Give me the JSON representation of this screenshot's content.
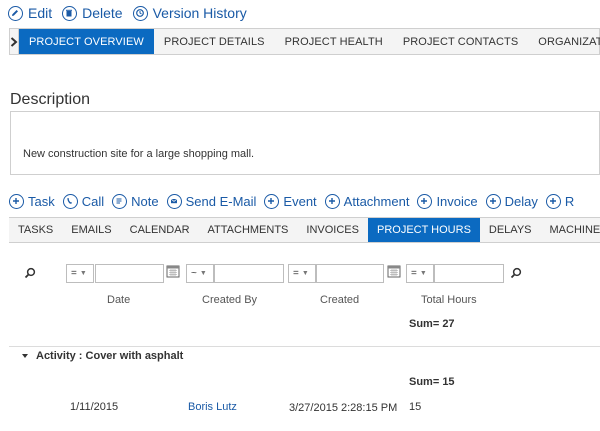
{
  "toolbar": {
    "edit_label": "Edit",
    "delete_label": "Delete",
    "version_history_label": "Version History"
  },
  "nav": {
    "tabs": [
      {
        "label": "PROJECT OVERVIEW",
        "active": true
      },
      {
        "label": "PROJECT DETAILS",
        "active": false
      },
      {
        "label": "PROJECT HEALTH",
        "active": false
      },
      {
        "label": "PROJECT CONTACTS",
        "active": false
      },
      {
        "label": "ORGANIZATIONS",
        "active": false
      }
    ]
  },
  "description": {
    "heading": "Description",
    "text": "New construction site for a large shopping mall."
  },
  "activities": {
    "items": [
      "Task",
      "Call",
      "Note",
      "Send E-Mail",
      "Event",
      "Attachment",
      "Invoice",
      "Delay",
      "R"
    ]
  },
  "subtabs": {
    "tabs": [
      {
        "label": "TASKS",
        "active": false
      },
      {
        "label": "EMAILS",
        "active": false
      },
      {
        "label": "CALENDAR",
        "active": false
      },
      {
        "label": "ATTACHMENTS",
        "active": false
      },
      {
        "label": "INVOICES",
        "active": false
      },
      {
        "label": "PROJECT HOURS",
        "active": true
      },
      {
        "label": "DELAYS",
        "active": false
      },
      {
        "label": "MACHINERY",
        "active": false
      }
    ]
  },
  "grid": {
    "filters": {
      "date_op": "=",
      "created_by_op": "~",
      "created_op": "=",
      "total_hours_op": "=",
      "date_value": "",
      "created_by_value": "",
      "created_value": "",
      "total_hours_value": ""
    },
    "columns": {
      "date": "Date",
      "created_by": "Created By",
      "created": "Created",
      "total_hours": "Total Hours"
    },
    "total_sum": "Sum= 27",
    "group": {
      "key": "Activity",
      "separator": " : ",
      "value": "Cover with asphalt",
      "sum": "Sum= 15"
    },
    "rows": [
      {
        "date": "1/11/2015",
        "created_by": "Boris Lutz",
        "created": "3/27/2015 2:28:15 PM",
        "total_hours": "15"
      }
    ]
  },
  "colors": {
    "accent": "#0b6ac1",
    "link": "#1a5aa6"
  }
}
